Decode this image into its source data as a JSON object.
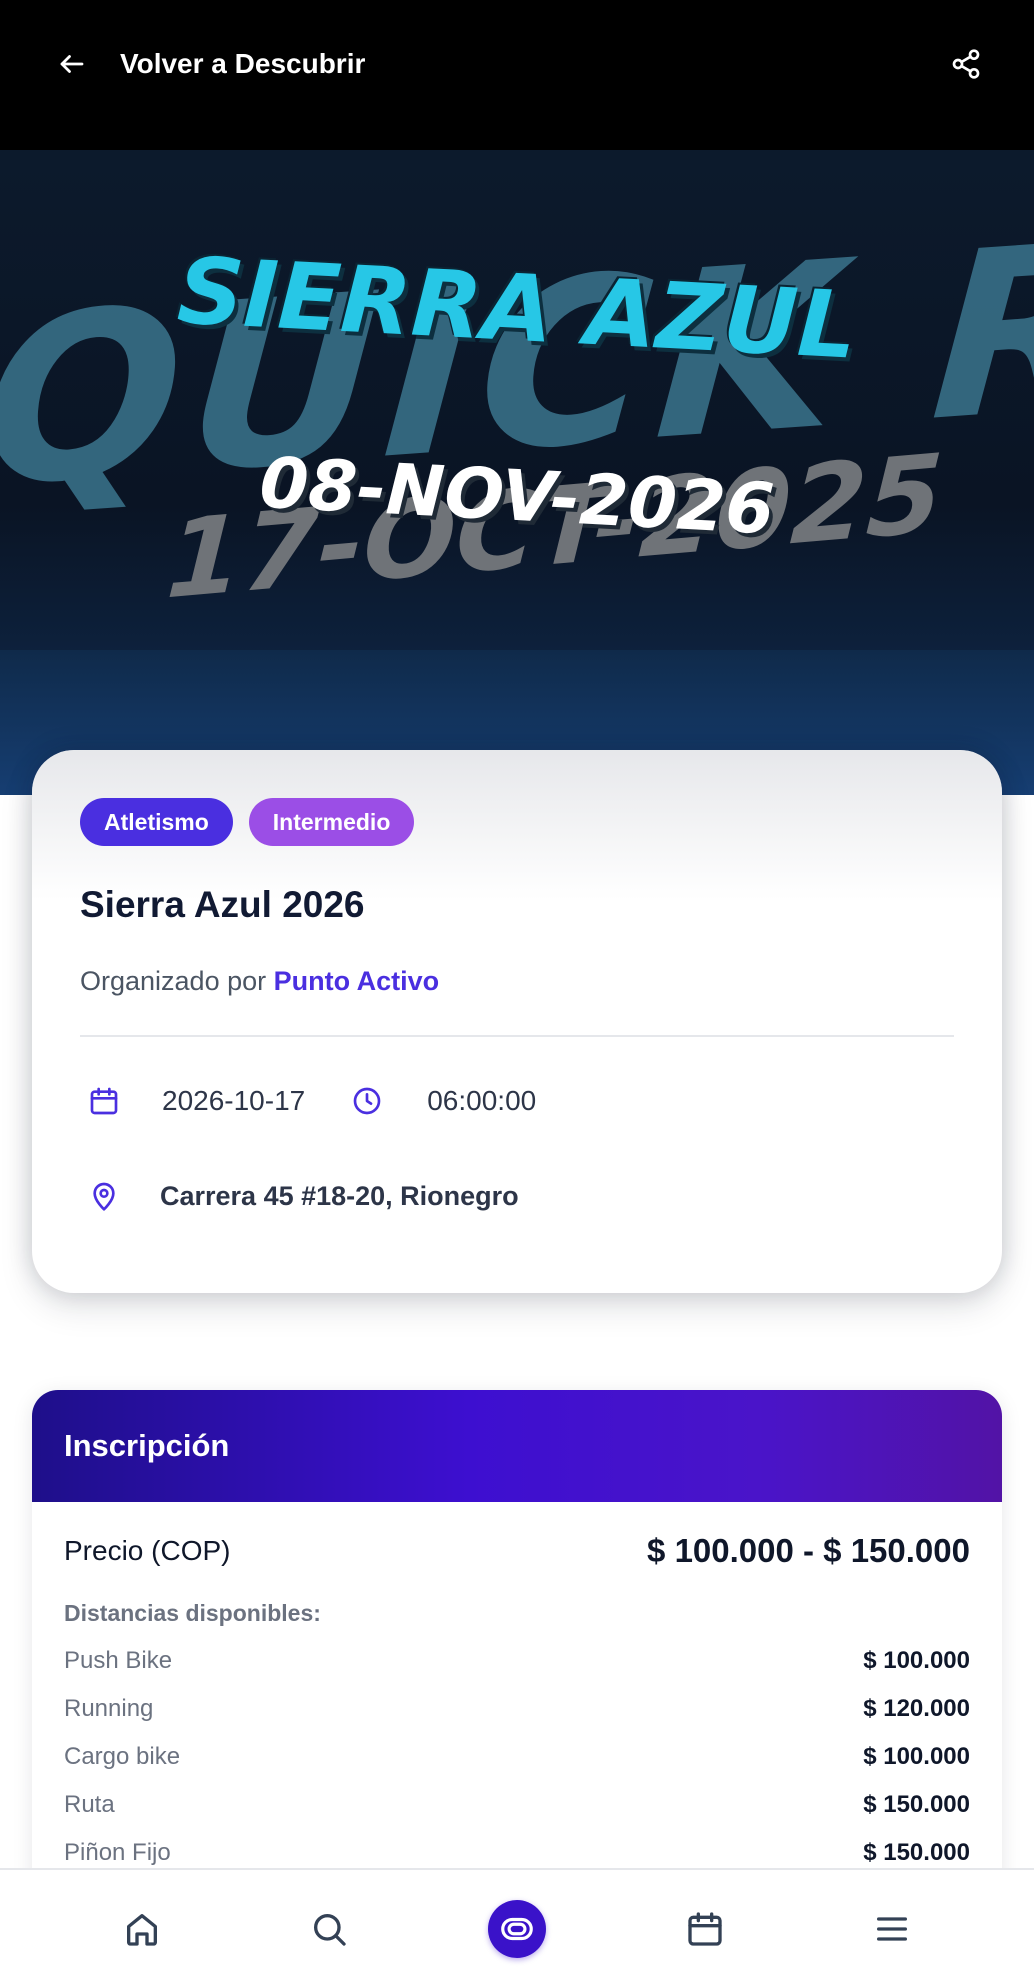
{
  "header": {
    "back_label": "Volver a Descubrir"
  },
  "hero": {
    "background_text": "QUICK RAC",
    "background_date": "17-OCT-2025",
    "title": "SIERRA AZUL",
    "date": "08-NOV-2026"
  },
  "event": {
    "tags": [
      "Atletismo",
      "Intermedio"
    ],
    "title": "Sierra Azul 2026",
    "organizer_prefix": "Organizado por",
    "organizer_name": "Punto Activo",
    "date": "2026-10-17",
    "time": "06:00:00",
    "location": "Carrera 45 #18-20, Rionegro"
  },
  "registration": {
    "title": "Inscripción",
    "price_label": "Precio (COP)",
    "price_range": "$ 100.000 - $ 150.000",
    "distances_heading": "Distancias disponibles:",
    "distances": [
      {
        "name": "Push Bike",
        "price": "$ 100.000"
      },
      {
        "name": "Running",
        "price": "$ 120.000"
      },
      {
        "name": "Cargo bike",
        "price": "$ 100.000"
      },
      {
        "name": "Ruta",
        "price": "$ 150.000"
      },
      {
        "name": "Piñon Fijo",
        "price": "$ 150.000"
      }
    ]
  },
  "nav": {
    "items": [
      "home-icon",
      "search-icon",
      "app-logo-icon",
      "calendar-icon",
      "menu-icon"
    ]
  },
  "colors": {
    "primary": "#4a2fe0",
    "secondary": "#9b4ee6",
    "header_bg": "#000000",
    "registration_gradient_start": "#1e0f8a",
    "registration_gradient_end": "#5213a6"
  }
}
